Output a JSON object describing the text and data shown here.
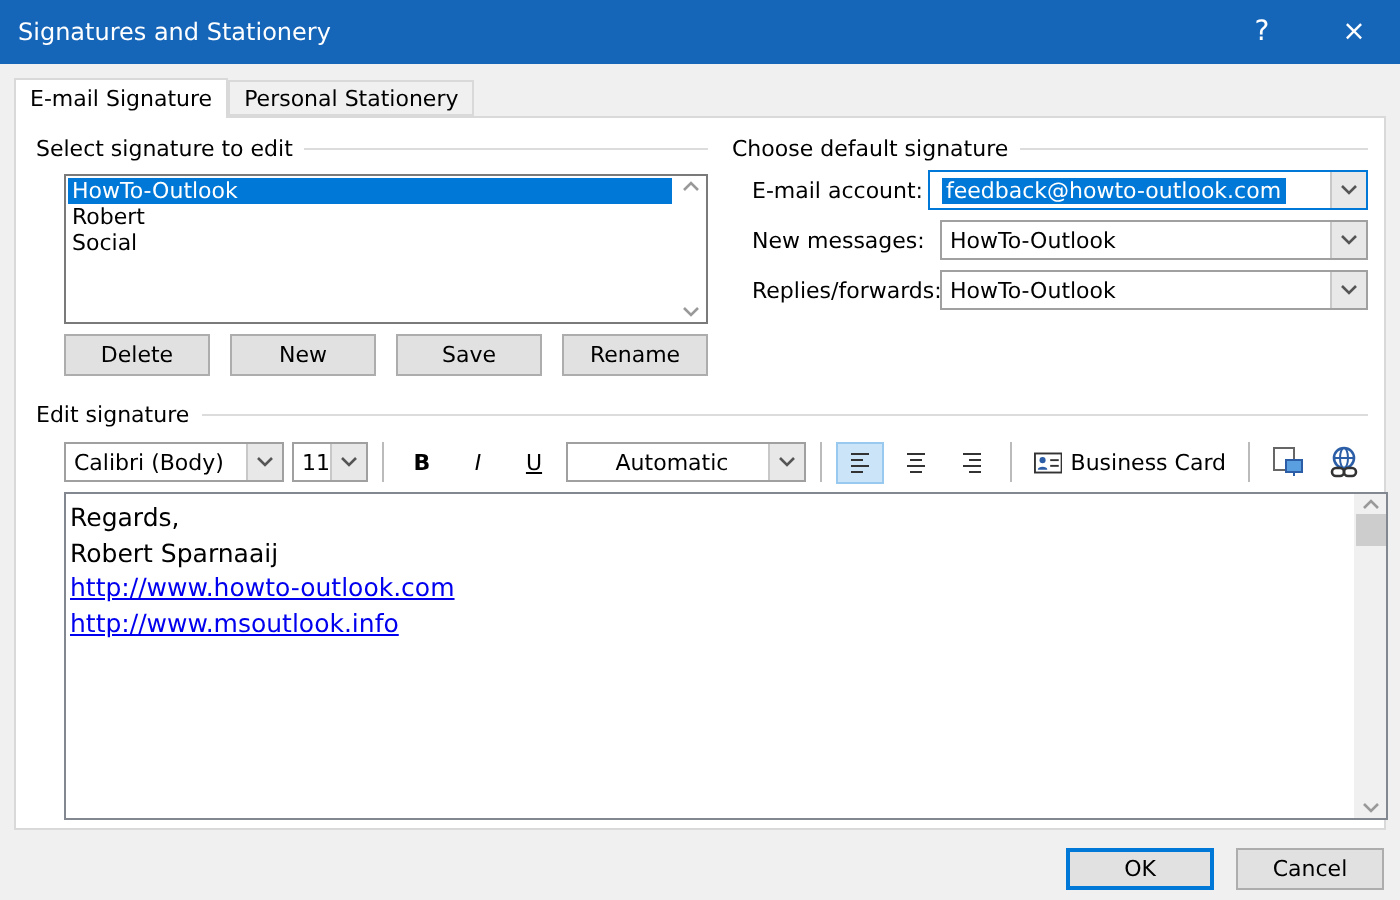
{
  "window": {
    "title": "Signatures and Stationery",
    "help": "?",
    "close": "×"
  },
  "tabs": [
    {
      "label": "E-mail Signature",
      "selected": true
    },
    {
      "label": "Personal Stationery",
      "selected": false
    }
  ],
  "select_signature": {
    "label": "Select signature to edit",
    "items": [
      {
        "label": "HowTo-Outlook",
        "selected": true
      },
      {
        "label": "Robert",
        "selected": false
      },
      {
        "label": "Social",
        "selected": false
      }
    ],
    "buttons": [
      "Delete",
      "New",
      "Save",
      "Rename"
    ]
  },
  "default_signature": {
    "label": "Choose default signature",
    "fields": [
      {
        "label": "E-mail account:",
        "value": "feedback@howto-outlook.com",
        "focused": true
      },
      {
        "label": "New messages:",
        "value": "HowTo-Outlook",
        "focused": false
      },
      {
        "label": "Replies/forwards:",
        "value": "HowTo-Outlook",
        "focused": false
      }
    ]
  },
  "edit_signature": {
    "label": "Edit signature",
    "font": "Calibri (Body)",
    "size": "11",
    "bold": "B",
    "italic": "I",
    "underline": "U",
    "font_color": "Automatic",
    "alignments": [
      {
        "kind": "left",
        "selected": true
      },
      {
        "kind": "center",
        "selected": false
      },
      {
        "kind": "right",
        "selected": false
      }
    ],
    "business_card": "Business Card",
    "lines": [
      {
        "kind": "text",
        "text": "Regards,"
      },
      {
        "kind": "text",
        "text": "Robert Sparnaaij"
      },
      {
        "kind": "link",
        "text": "http://www.howto-outlook.com"
      },
      {
        "kind": "link",
        "text": "http://www.msoutlook.info"
      }
    ]
  },
  "footer_buttons": [
    {
      "label": "OK",
      "default": true
    },
    {
      "label": "Cancel",
      "default": false
    }
  ]
}
